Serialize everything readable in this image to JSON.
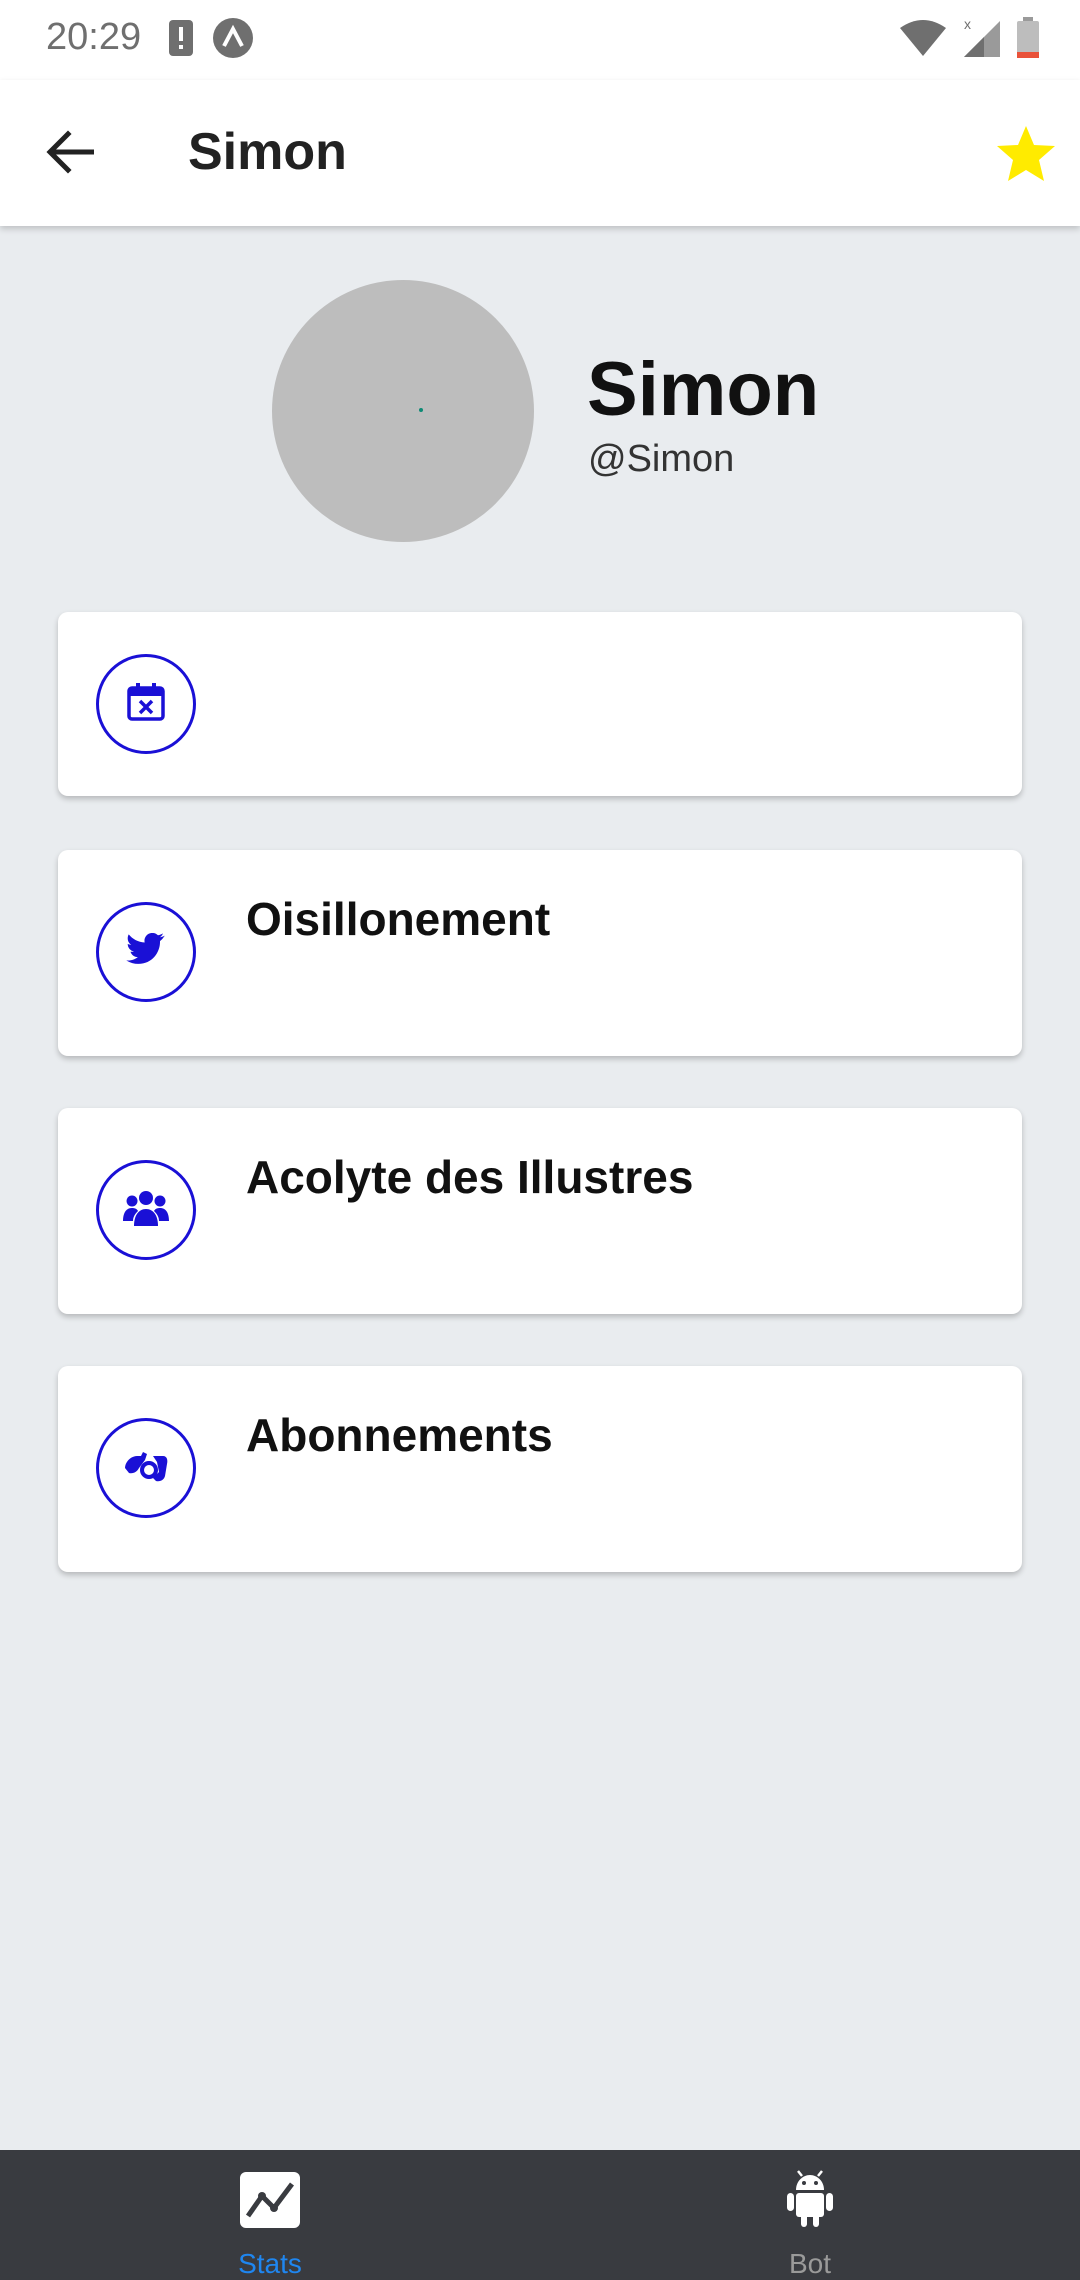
{
  "status_bar": {
    "time": "20:29",
    "left_icons": [
      "alert-icon",
      "app-logo-icon"
    ],
    "right_icons": [
      "wifi-icon",
      "signal-icon",
      "battery-icon"
    ]
  },
  "app_bar": {
    "title": "Simon",
    "back_icon": "arrow-back-icon",
    "favorite_icon": "star-icon",
    "favorite_color": "#ffeb00"
  },
  "profile": {
    "name": "Simon",
    "handle": "@Simon"
  },
  "cards": [
    {
      "icon": "calendar-x-icon",
      "label": ""
    },
    {
      "icon": "twitter-bird-icon",
      "label": "Oisillonement"
    },
    {
      "icon": "group-icon",
      "label": "Acolyte des Illustres"
    },
    {
      "icon": "hands-icon",
      "label": "Abonnements"
    }
  ],
  "accent_color": "#1a10d6",
  "bottom_nav": {
    "items": [
      {
        "label": "Stats",
        "icon": "chart-line-icon",
        "active": true
      },
      {
        "label": "Bot",
        "icon": "android-icon",
        "active": false
      }
    ]
  }
}
